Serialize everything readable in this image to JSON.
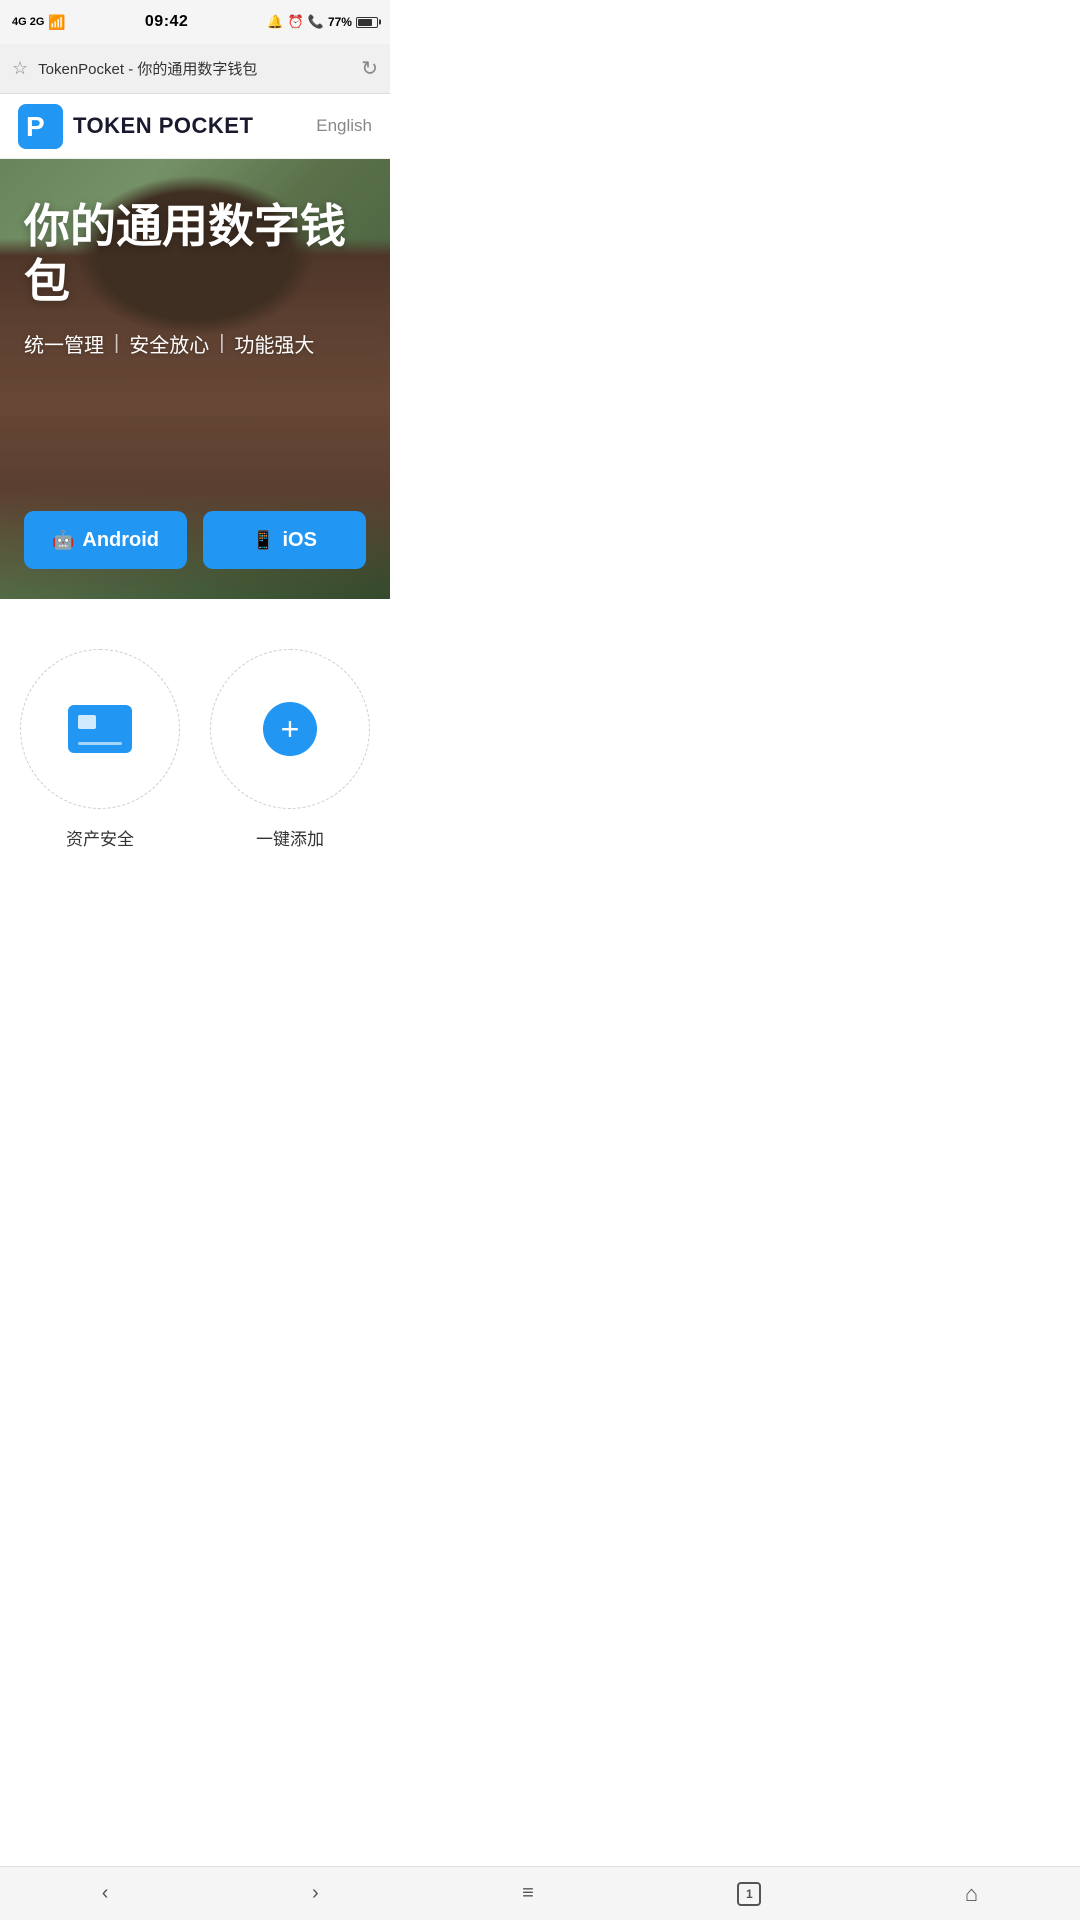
{
  "statusBar": {
    "signal": "4G  2G",
    "time": "09:42",
    "battery": "77%"
  },
  "browserBar": {
    "url": "TokenPocket - 你的通用数字钱包",
    "starIcon": "☆",
    "refreshIcon": "↻"
  },
  "header": {
    "logoText": "TOKEN POCKET",
    "langButton": "English"
  },
  "hero": {
    "title": "你的通用数字钱包",
    "subtitle1": "统一管理",
    "subtitle2": "安全放心",
    "subtitle3": "功能强大",
    "divider": "|",
    "androidButton": "Android",
    "iosButton": "iOS"
  },
  "features": [
    {
      "iconType": "card",
      "label": "资产安全"
    },
    {
      "iconType": "plus",
      "label": "一键添加"
    }
  ],
  "bottomNav": {
    "backLabel": "‹",
    "forwardLabel": "›",
    "menuLabel": "≡",
    "tabsLabel": "1",
    "homeLabel": "⌂"
  }
}
